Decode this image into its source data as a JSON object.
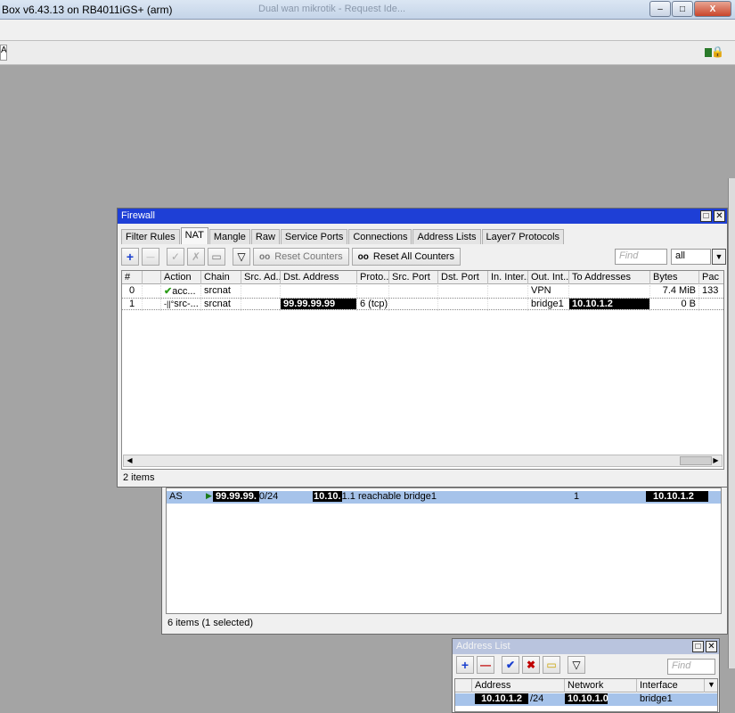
{
  "app": {
    "title": "Box v6.43.13 on RB4011iGS+ (arm)",
    "ghost_title": "Dual wan mikrotik - Request Ide...",
    "win_min": "–",
    "win_max": "□",
    "win_close": "X",
    "toolbar_field": "A"
  },
  "firewall": {
    "title": "Firewall",
    "tabs": [
      {
        "label": "Filter Rules"
      },
      {
        "label": "NAT"
      },
      {
        "label": "Mangle"
      },
      {
        "label": "Raw"
      },
      {
        "label": "Service Ports"
      },
      {
        "label": "Connections"
      },
      {
        "label": "Address Lists"
      },
      {
        "label": "Layer7 Protocols"
      }
    ],
    "buttons": {
      "add": "+",
      "remove": "—",
      "enable": "✓",
      "disable": "✗",
      "comment": "▭",
      "filter": "▽",
      "oo": "oo",
      "reset_counters": "Reset Counters",
      "reset_all_counters": "Reset All Counters"
    },
    "find_placeholder": "Find",
    "filter_value": "all",
    "columns": [
      "#",
      "",
      "Action",
      "Chain",
      "Src. Ad...",
      "Dst. Address",
      "Proto...",
      "Src. Port",
      "Dst. Port",
      "In. Inter...",
      "Out. Int...",
      "To Addresses",
      "Bytes",
      "Pac"
    ],
    "rows": [
      {
        "num": "0",
        "icon": "✔",
        "action": "acc...",
        "chain": "srcnat",
        "src": "",
        "dst": "",
        "proto": "",
        "sport": "",
        "dport": "",
        "inif": "",
        "outif": "VPN",
        "to": "",
        "bytes": "7.4 MiB",
        "pac": "133"
      },
      {
        "num": "1",
        "icon": "-||°",
        "action": "src-...",
        "chain": "srcnat",
        "src": "",
        "dst": "99.99.99.99",
        "proto": "6 (tcp)",
        "sport": "",
        "dport": "",
        "inif": "",
        "outif": "bridge1",
        "to": "10.10.1.2",
        "bytes": "0 B",
        "pac": ""
      }
    ],
    "status": "2 items"
  },
  "route_list": {
    "row": {
      "flag": "AS",
      "dst_a": "99.99.99.",
      "dst_b": "0/24",
      "gw_a": "10.10.",
      "gw_b": "1.1 reachable bridge1",
      "distance": "1",
      "pref": "10.10.1.2"
    },
    "status": "6 items (1 selected)"
  },
  "address_list": {
    "title": "Address List",
    "find_placeholder": "Find",
    "columns": [
      "Address",
      "Network",
      "Interface"
    ],
    "row": {
      "address": "10.10.1.2",
      "mask": "/24",
      "network": "10.10.1.0",
      "interface": "bridge1"
    }
  },
  "colors": {
    "title_active": "#1e3fd6",
    "selected_row": "#a6c3ea",
    "redact": "#000000"
  }
}
